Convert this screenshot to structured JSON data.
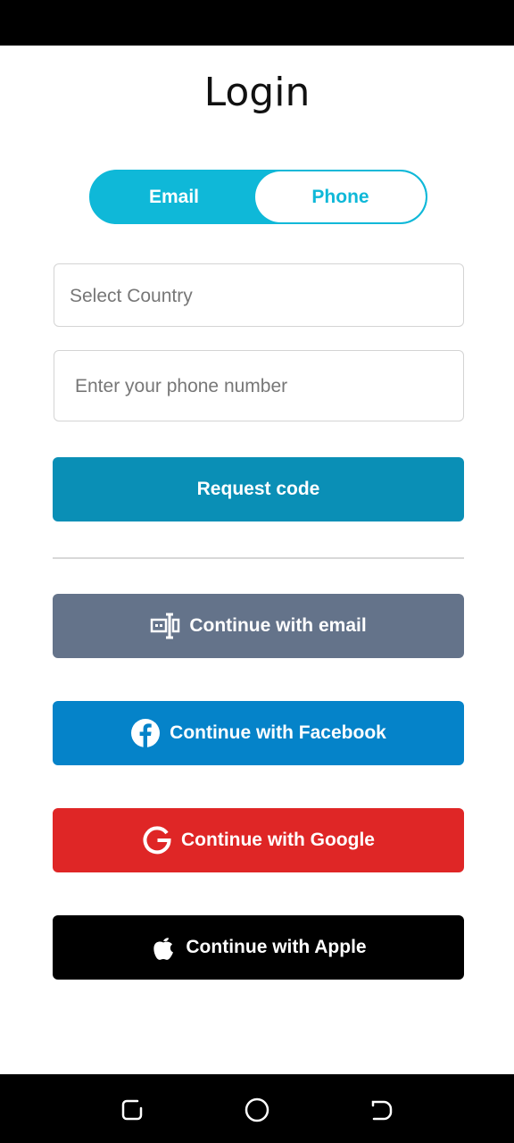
{
  "page": {
    "title": "Login"
  },
  "toggle": {
    "email_label": "Email",
    "phone_label": "Phone",
    "selected": "Phone"
  },
  "form": {
    "country_placeholder": "Select Country",
    "phone_placeholder": "Enter your phone number",
    "request_label": "Request code"
  },
  "social": {
    "email_label": "Continue with email",
    "facebook_label": "Continue with Facebook",
    "google_label": "Continue with Google",
    "apple_label": "Continue with Apple"
  },
  "colors": {
    "accent": "#0fb8d8",
    "request": "#0a8fb6",
    "email": "#64738a",
    "facebook": "#0583c9",
    "google": "#df2626",
    "apple": "#000000"
  },
  "icons": {
    "email": "email-form-icon",
    "facebook": "facebook-icon",
    "google": "google-icon",
    "apple": "apple-icon",
    "nav": [
      "recent-apps-icon",
      "home-icon",
      "back-icon"
    ]
  }
}
